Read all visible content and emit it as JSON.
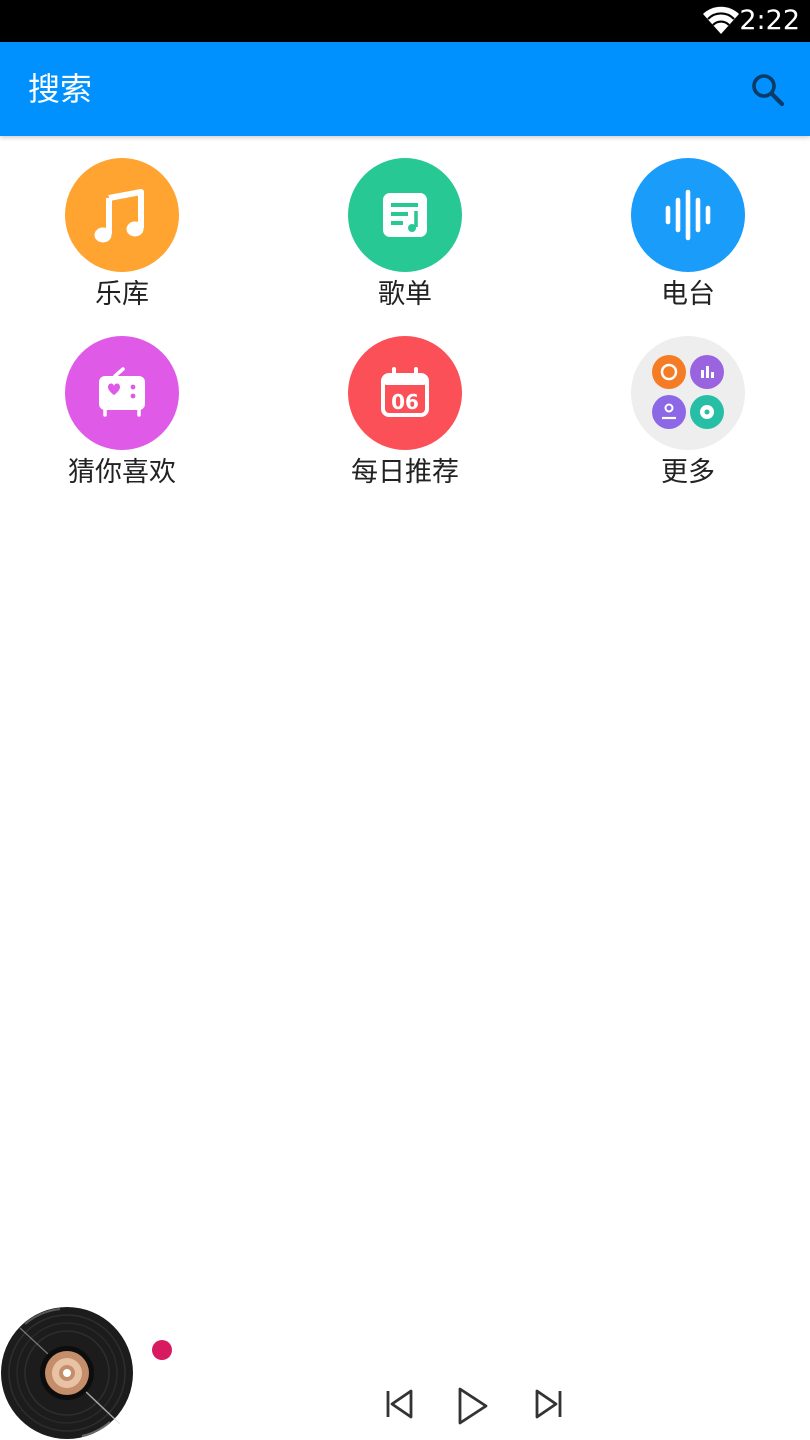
{
  "status_bar": {
    "time": "2:22",
    "wifi_icon": "wifi-icon"
  },
  "toolbar": {
    "title": "搜索",
    "search_icon": "search-icon",
    "color": "#0091ff"
  },
  "grid": {
    "items": [
      {
        "label": "乐库",
        "icon": "music-note-icon",
        "color": "#ffa431"
      },
      {
        "label": "歌单",
        "icon": "playlist-icon",
        "color": "#27c893"
      },
      {
        "label": "电台",
        "icon": "sound-wave-icon",
        "color": "#1a9cfb"
      },
      {
        "label": "猜你喜欢",
        "icon": "heart-radio-icon",
        "color": "#e05ae8"
      },
      {
        "label": "每日推荐",
        "icon": "calendar-icon",
        "color": "#fb5058"
      },
      {
        "label": "更多",
        "icon": "more-grid-icon",
        "color": "#eeeeee"
      }
    ],
    "calendar_day": "06"
  },
  "player": {
    "vinyl_icon": "vinyl-record-icon",
    "indicator_color": "#d81b60",
    "prev_icon": "skip-previous-icon",
    "play_icon": "play-icon",
    "next_icon": "skip-next-icon"
  }
}
